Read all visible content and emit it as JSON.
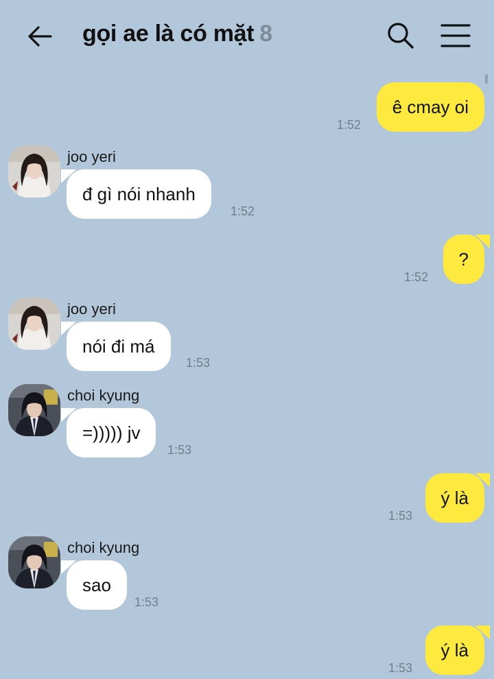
{
  "header": {
    "title": "gọi ae là có mặt",
    "member_count": "8",
    "back_icon": "arrow-left-icon",
    "search_icon": "search-icon",
    "menu_icon": "hamburger-menu-icon"
  },
  "colors": {
    "background": "#b2c7d9",
    "my_bubble": "#fee93f",
    "their_bubble": "#ffffff",
    "time_text": "#6e7e8c",
    "count_text": "#7d8c9a"
  },
  "messages": [
    {
      "sender_type": "me",
      "text": "ê cmay oi",
      "time": "1:52"
    },
    {
      "sender_type": "them",
      "sender": "joo yeri",
      "text": "đ gì nói nhanh",
      "time": "1:52"
    },
    {
      "sender_type": "me",
      "text": "?",
      "time": "1:52"
    },
    {
      "sender_type": "them",
      "sender": "joo yeri",
      "text": "nói đi má",
      "time": "1:53"
    },
    {
      "sender_type": "them",
      "sender": "choi kyung",
      "text": "=))))) jv",
      "time": "1:53"
    },
    {
      "sender_type": "me",
      "text": "ý là",
      "time": "1:53"
    },
    {
      "sender_type": "them",
      "sender": "choi kyung",
      "text": "sao",
      "time": "1:53"
    },
    {
      "sender_type": "me",
      "text": "ý là",
      "time": "1:53"
    }
  ]
}
